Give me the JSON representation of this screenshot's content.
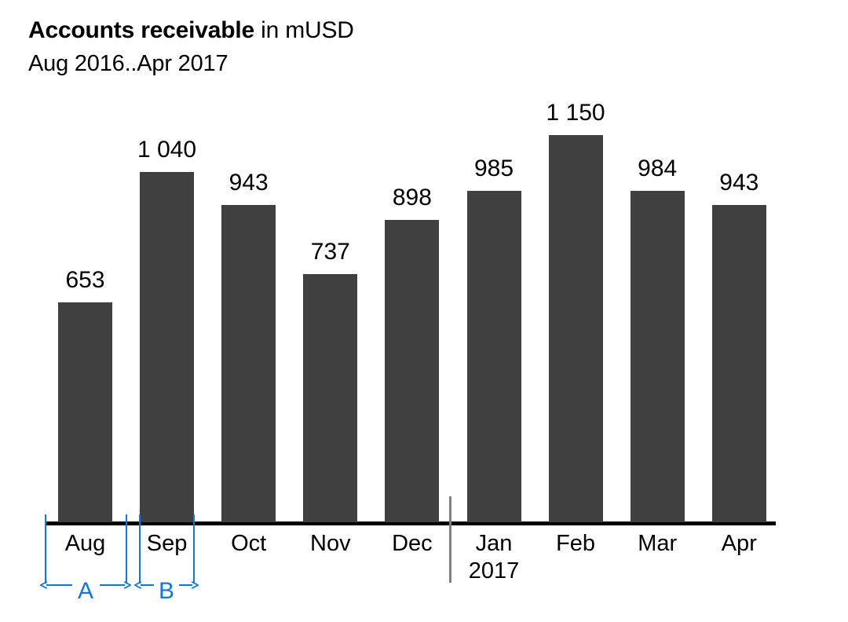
{
  "header": {
    "title_strong": "Accounts receivable",
    "title_rest": " in mUSD",
    "subtitle": "Aug 2016..Apr 2017"
  },
  "chart_data": {
    "type": "bar",
    "title": "Accounts receivable in mUSD",
    "subtitle": "Aug 2016..Apr 2017",
    "xlabel": "",
    "ylabel": "mUSD",
    "grid": false,
    "legend": "none",
    "axis_visible": "x-only",
    "ylim": [
      0,
      1150
    ],
    "categories": [
      "Aug",
      "Sep",
      "Oct",
      "Nov",
      "Dec",
      "Jan",
      "Feb",
      "Mar",
      "Apr"
    ],
    "category_sublabels": [
      "",
      "",
      "",
      "",
      "",
      "2017",
      "",
      "",
      ""
    ],
    "values": [
      653,
      1040,
      943,
      737,
      898,
      985,
      1150,
      984,
      943
    ],
    "value_labels": [
      "653",
      "1 040",
      "943",
      "737",
      "898",
      "985",
      "1 150",
      "984",
      "943"
    ],
    "bar_color": "#404040",
    "annotations": [
      {
        "label": "A",
        "meaning": "category slot width",
        "from_category": "Aug",
        "to_category": "Aug"
      },
      {
        "label": "B",
        "meaning": "bar width",
        "from_category": "Sep",
        "to_category": "Sep"
      }
    ],
    "period_divider_after": "Dec",
    "period_divider_color": "#808080",
    "annotation_color": "#0a78e8"
  }
}
